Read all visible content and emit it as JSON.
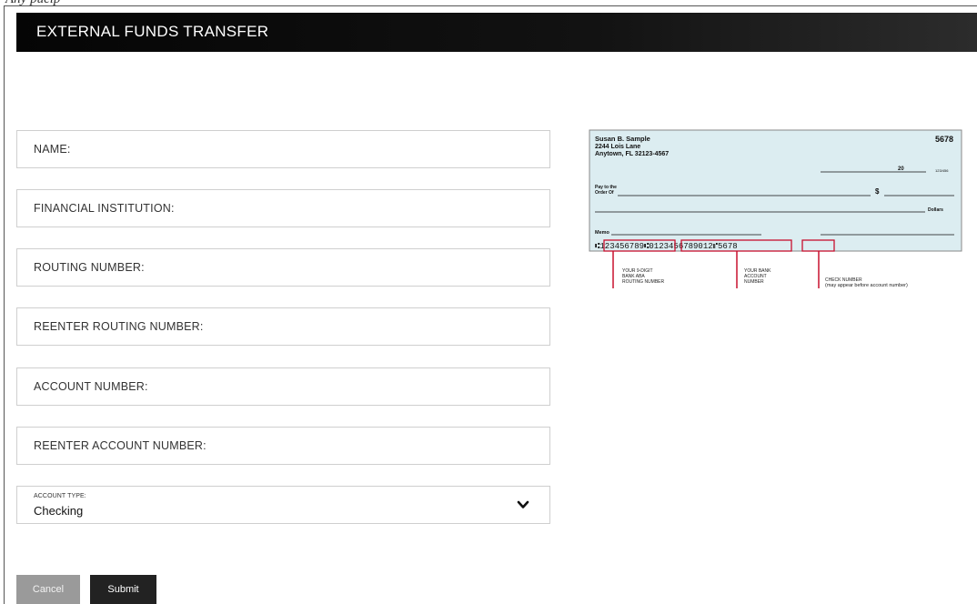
{
  "top_fragment": "Any pucip",
  "header": {
    "title": "EXTERNAL FUNDS TRANSFER"
  },
  "form": {
    "fields": [
      {
        "label": "NAME:"
      },
      {
        "label": "FINANCIAL INSTITUTION:"
      },
      {
        "label": "ROUTING NUMBER:"
      },
      {
        "label": "REENTER ROUTING NUMBER:"
      },
      {
        "label": "ACCOUNT NUMBER:"
      },
      {
        "label": "REENTER ACCOUNT NUMBER:"
      }
    ],
    "account_type": {
      "label": "ACCOUNT TYPE:",
      "value": "Checking"
    }
  },
  "buttons": {
    "cancel": "Cancel",
    "submit": "Submit"
  },
  "check": {
    "name": "Susan B. Sample",
    "address1": "2244 Lois Lane",
    "address2": "Anytown, FL 32123-4567",
    "number": "5678",
    "date_label": "20",
    "fraction": "123/456",
    "pay_to_1": "Pay to the",
    "pay_to_2": "Order Of",
    "dollar_sign": "$",
    "dollars": "Dollars",
    "memo": "Memo",
    "micr": "⑆123456789⑆0123456789012⑈5678",
    "routing_label_1": "YOUR 9-DIGIT",
    "routing_label_2": "BANK ABA",
    "routing_label_3": "ROUTING NUMBER",
    "account_label_1": "YOUR BANK",
    "account_label_2": "ACCOUNT",
    "account_label_3": "NUMBER",
    "checknum_label_1": "CHECK NUMBER",
    "checknum_label_2": "(may appear before account number)"
  },
  "colors": {
    "header_bg": "#0a0a0a",
    "check_bg": "#dcedf1",
    "accent_red": "#c8102e",
    "submit_bg": "#222222",
    "cancel_bg": "#9a9a9a"
  }
}
